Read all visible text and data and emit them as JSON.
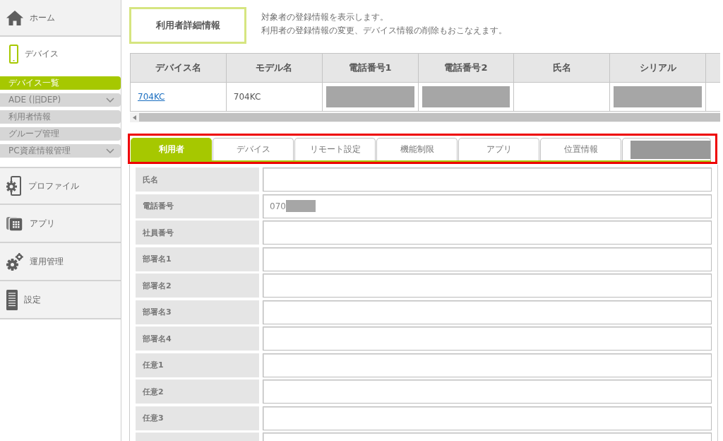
{
  "sidebar": {
    "items": [
      {
        "label": "ホーム",
        "selected": false
      },
      {
        "label": "デバイス",
        "selected": true,
        "children": [
          {
            "label": "デバイス一覧",
            "selected": true,
            "expandable": false
          },
          {
            "label": "ADE (旧DEP)",
            "selected": false,
            "expandable": true
          },
          {
            "label": "利用者情報",
            "selected": false,
            "expandable": false
          },
          {
            "label": "グループ管理",
            "selected": false,
            "expandable": false
          },
          {
            "label": "PC資産情報管理",
            "selected": false,
            "expandable": true
          }
        ]
      },
      {
        "label": "プロファイル",
        "selected": false
      },
      {
        "label": "アプリ",
        "selected": false
      },
      {
        "label": "運用管理",
        "selected": false
      },
      {
        "label": "設定",
        "selected": false
      }
    ]
  },
  "page_title": "利用者詳細情報",
  "description": [
    "対象者の登録情報を表示します。",
    "利用者の登録情報の変更、デバイス情報の削除もおこなえます。"
  ],
  "device_table": {
    "columns": [
      "デバイス名",
      "モデル名",
      "電話番号1",
      "電話番号2",
      "氏名",
      "シリアル"
    ],
    "more_columns": true,
    "rows": [
      {
        "cells": [
          {
            "kind": "link",
            "text": "704KC"
          },
          {
            "kind": "text",
            "text": "704KC"
          },
          {
            "kind": "redacted"
          },
          {
            "kind": "redacted"
          },
          {
            "kind": "empty"
          },
          {
            "kind": "redacted"
          }
        ]
      }
    ]
  },
  "tabs": {
    "highlighted": true,
    "items": [
      {
        "kind": "text",
        "label": "利用者",
        "selected": true
      },
      {
        "kind": "text",
        "label": "デバイス",
        "selected": false
      },
      {
        "kind": "text",
        "label": "リモート設定",
        "selected": false
      },
      {
        "kind": "text",
        "label": "機能制限",
        "selected": false
      },
      {
        "kind": "text",
        "label": "アプリ",
        "selected": false
      },
      {
        "kind": "text",
        "label": "位置情報",
        "selected": false
      },
      {
        "kind": "redacted",
        "selected": false
      }
    ]
  },
  "form": {
    "fields": [
      {
        "label": "氏名",
        "redacted": false
      },
      {
        "label": "電話番号",
        "value": "070",
        "redacted": true
      },
      {
        "label": "社員番号",
        "redacted": false
      },
      {
        "label": "部署名1",
        "redacted": false
      },
      {
        "label": "部署名2",
        "redacted": false
      },
      {
        "label": "部署名3",
        "redacted": false
      },
      {
        "label": "部署名4",
        "redacted": false
      },
      {
        "label": "任意1",
        "redacted": false
      },
      {
        "label": "任意2",
        "redacted": false
      },
      {
        "label": "任意3",
        "redacted": false
      }
    ],
    "partial_row": true
  }
}
